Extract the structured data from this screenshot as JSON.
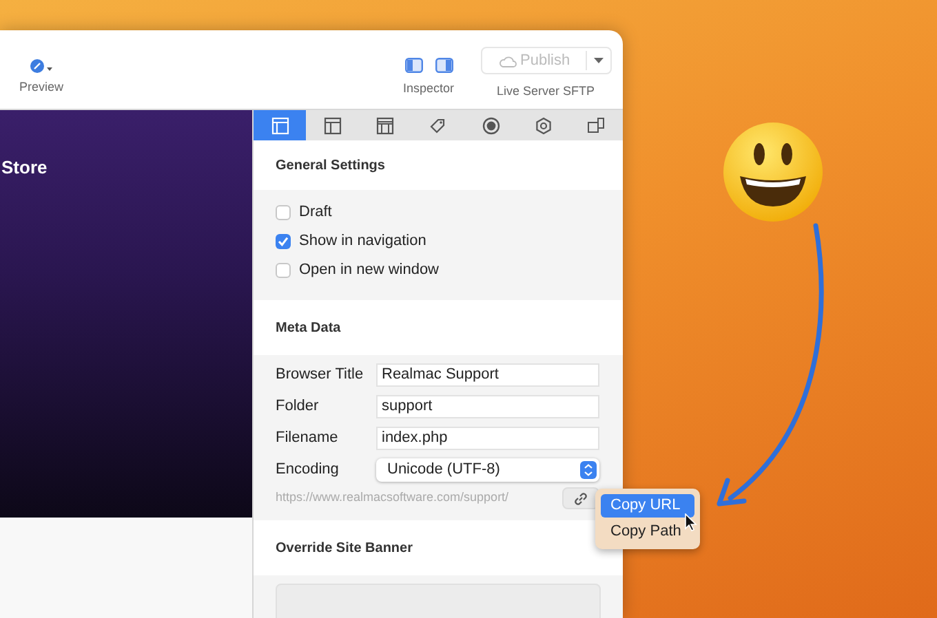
{
  "toolbar": {
    "preview": {
      "label": "Preview"
    },
    "inspector": {
      "label": "Inspector"
    },
    "publish": {
      "label": "Publish",
      "disabled": true,
      "server": "Live Server SFTP"
    }
  },
  "preview": {
    "heading": "Store"
  },
  "inspector_tabs": [
    {
      "kind": "page",
      "selected": true
    },
    {
      "kind": "layout",
      "selected": false
    },
    {
      "kind": "header",
      "selected": false
    },
    {
      "kind": "tag",
      "selected": false
    },
    {
      "kind": "circle",
      "selected": false
    },
    {
      "kind": "gear",
      "selected": false
    },
    {
      "kind": "devices",
      "selected": false
    }
  ],
  "general_settings": {
    "title": "General Settings",
    "options": [
      {
        "label": "Draft",
        "checked": false
      },
      {
        "label": "Show in navigation",
        "checked": true
      },
      {
        "label": "Open in new window",
        "checked": false
      }
    ]
  },
  "meta_data": {
    "title": "Meta Data",
    "fields": [
      {
        "label": "Browser Title",
        "value": "Realmac Support",
        "kind": "text"
      },
      {
        "label": "Folder",
        "value": "support",
        "kind": "text"
      },
      {
        "label": "Filename",
        "value": "index.php",
        "kind": "text"
      },
      {
        "label": "Encoding",
        "value": "Unicode (UTF-8)",
        "kind": "select"
      }
    ],
    "url": "https://www.realmacsoftware.com/support/"
  },
  "link_menu": [
    {
      "label": "Copy URL",
      "selected": true
    },
    {
      "label": "Copy Path",
      "selected": false
    }
  ],
  "override_banner": {
    "title": "Override Site Banner"
  }
}
